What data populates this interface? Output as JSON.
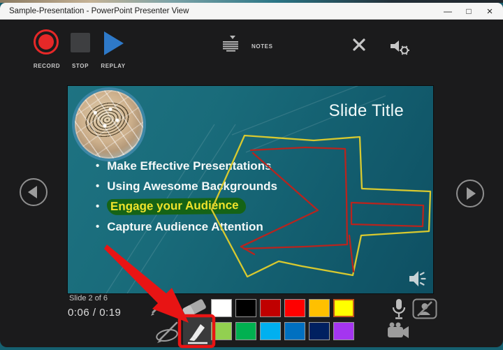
{
  "titlebar": {
    "title": "Sample-Presentation - PowerPoint Presenter View",
    "minimize_glyph": "—",
    "maximize_glyph": "□",
    "close_glyph": "×"
  },
  "toolbar": {
    "record": "RECORD",
    "stop": "STOP",
    "replay": "REPLAY",
    "notes": "NOTES"
  },
  "slide": {
    "title": "Slide Title",
    "bullets": [
      {
        "text": "Make Effective Presentations",
        "highlighted": false
      },
      {
        "text": "Using Awesome Backgrounds",
        "highlighted": false
      },
      {
        "text": "Engage your Audience",
        "highlighted": true
      },
      {
        "text": "Capture Audience Attention",
        "highlighted": false
      }
    ]
  },
  "status": {
    "slide_label": "Slide 2 of 6",
    "timer": "0:06 / 0:19"
  },
  "palette": {
    "row1": [
      "#FFFFFF",
      "#000000",
      "#C00000",
      "#FF0000",
      "#FFC000",
      "#FFFF00"
    ],
    "row2": [
      "#92D050",
      "#00B050",
      "#00B0F0",
      "#0070C0",
      "#002060",
      "#A435F0"
    ],
    "selected": "#FFFF00"
  },
  "colors": {
    "accent-red": "#E62828",
    "replay-blue": "#2E79C8",
    "pen-red": "#B8241E",
    "pen-yellow": "#D8C92F",
    "callout-red": "#E81414",
    "hl-band": "#156316",
    "hl-text": "#EFE32B"
  }
}
